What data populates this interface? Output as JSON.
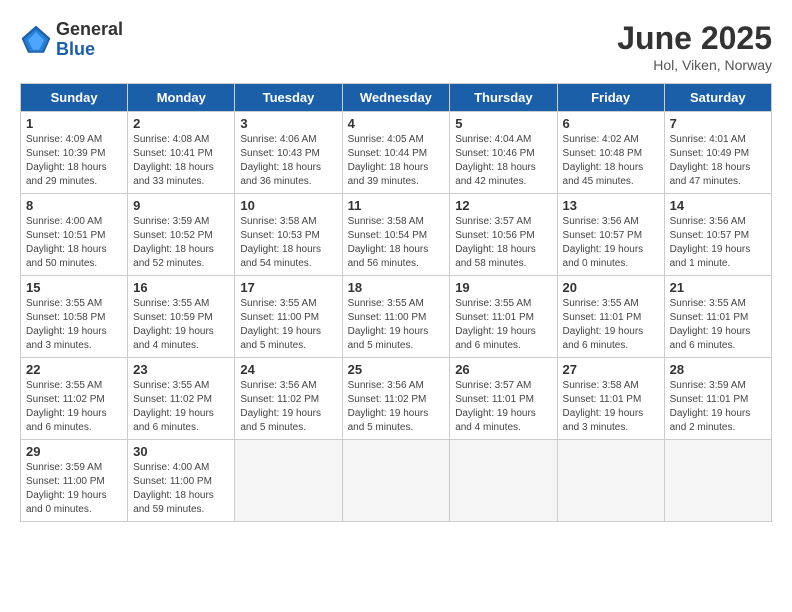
{
  "logo": {
    "general": "General",
    "blue": "Blue"
  },
  "title": "June 2025",
  "subtitle": "Hol, Viken, Norway",
  "headers": [
    "Sunday",
    "Monday",
    "Tuesday",
    "Wednesday",
    "Thursday",
    "Friday",
    "Saturday"
  ],
  "weeks": [
    [
      {
        "day": "1",
        "sunrise": "4:09 AM",
        "sunset": "10:39 PM",
        "daylight": "18 hours and 29 minutes."
      },
      {
        "day": "2",
        "sunrise": "4:08 AM",
        "sunset": "10:41 PM",
        "daylight": "18 hours and 33 minutes."
      },
      {
        "day": "3",
        "sunrise": "4:06 AM",
        "sunset": "10:43 PM",
        "daylight": "18 hours and 36 minutes."
      },
      {
        "day": "4",
        "sunrise": "4:05 AM",
        "sunset": "10:44 PM",
        "daylight": "18 hours and 39 minutes."
      },
      {
        "day": "5",
        "sunrise": "4:04 AM",
        "sunset": "10:46 PM",
        "daylight": "18 hours and 42 minutes."
      },
      {
        "day": "6",
        "sunrise": "4:02 AM",
        "sunset": "10:48 PM",
        "daylight": "18 hours and 45 minutes."
      },
      {
        "day": "7",
        "sunrise": "4:01 AM",
        "sunset": "10:49 PM",
        "daylight": "18 hours and 47 minutes."
      }
    ],
    [
      {
        "day": "8",
        "sunrise": "4:00 AM",
        "sunset": "10:51 PM",
        "daylight": "18 hours and 50 minutes."
      },
      {
        "day": "9",
        "sunrise": "3:59 AM",
        "sunset": "10:52 PM",
        "daylight": "18 hours and 52 minutes."
      },
      {
        "day": "10",
        "sunrise": "3:58 AM",
        "sunset": "10:53 PM",
        "daylight": "18 hours and 54 minutes."
      },
      {
        "day": "11",
        "sunrise": "3:58 AM",
        "sunset": "10:54 PM",
        "daylight": "18 hours and 56 minutes."
      },
      {
        "day": "12",
        "sunrise": "3:57 AM",
        "sunset": "10:56 PM",
        "daylight": "18 hours and 58 minutes."
      },
      {
        "day": "13",
        "sunrise": "3:56 AM",
        "sunset": "10:57 PM",
        "daylight": "19 hours and 0 minutes."
      },
      {
        "day": "14",
        "sunrise": "3:56 AM",
        "sunset": "10:57 PM",
        "daylight": "19 hours and 1 minute."
      }
    ],
    [
      {
        "day": "15",
        "sunrise": "3:55 AM",
        "sunset": "10:58 PM",
        "daylight": "19 hours and 3 minutes."
      },
      {
        "day": "16",
        "sunrise": "3:55 AM",
        "sunset": "10:59 PM",
        "daylight": "19 hours and 4 minutes."
      },
      {
        "day": "17",
        "sunrise": "3:55 AM",
        "sunset": "11:00 PM",
        "daylight": "19 hours and 5 minutes."
      },
      {
        "day": "18",
        "sunrise": "3:55 AM",
        "sunset": "11:00 PM",
        "daylight": "19 hours and 5 minutes."
      },
      {
        "day": "19",
        "sunrise": "3:55 AM",
        "sunset": "11:01 PM",
        "daylight": "19 hours and 6 minutes."
      },
      {
        "day": "20",
        "sunrise": "3:55 AM",
        "sunset": "11:01 PM",
        "daylight": "19 hours and 6 minutes."
      },
      {
        "day": "21",
        "sunrise": "3:55 AM",
        "sunset": "11:01 PM",
        "daylight": "19 hours and 6 minutes."
      }
    ],
    [
      {
        "day": "22",
        "sunrise": "3:55 AM",
        "sunset": "11:02 PM",
        "daylight": "19 hours and 6 minutes."
      },
      {
        "day": "23",
        "sunrise": "3:55 AM",
        "sunset": "11:02 PM",
        "daylight": "19 hours and 6 minutes."
      },
      {
        "day": "24",
        "sunrise": "3:56 AM",
        "sunset": "11:02 PM",
        "daylight": "19 hours and 5 minutes."
      },
      {
        "day": "25",
        "sunrise": "3:56 AM",
        "sunset": "11:02 PM",
        "daylight": "19 hours and 5 minutes."
      },
      {
        "day": "26",
        "sunrise": "3:57 AM",
        "sunset": "11:01 PM",
        "daylight": "19 hours and 4 minutes."
      },
      {
        "day": "27",
        "sunrise": "3:58 AM",
        "sunset": "11:01 PM",
        "daylight": "19 hours and 3 minutes."
      },
      {
        "day": "28",
        "sunrise": "3:59 AM",
        "sunset": "11:01 PM",
        "daylight": "19 hours and 2 minutes."
      }
    ],
    [
      {
        "day": "29",
        "sunrise": "3:59 AM",
        "sunset": "11:00 PM",
        "daylight": "19 hours and 0 minutes."
      },
      {
        "day": "30",
        "sunrise": "4:00 AM",
        "sunset": "11:00 PM",
        "daylight": "18 hours and 59 minutes."
      },
      null,
      null,
      null,
      null,
      null
    ]
  ]
}
